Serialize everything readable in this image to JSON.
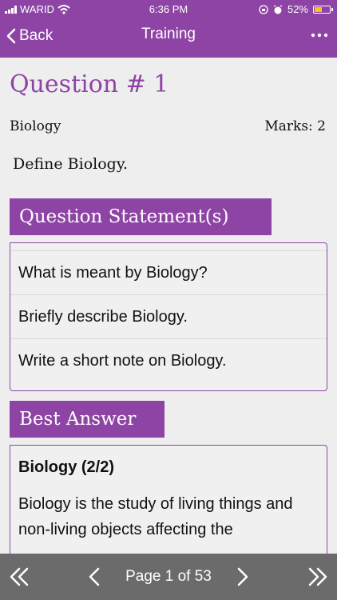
{
  "status": {
    "carrier": "WARID",
    "time": "6:36 PM",
    "battery": "52%",
    "battery_level": 0.52
  },
  "nav": {
    "back_label": "Back",
    "title": "Training"
  },
  "question": {
    "title": "Question # 1",
    "subject": "Biology",
    "marks": "Marks: 2",
    "text": "Define Biology."
  },
  "statements": {
    "header": "Question Statement(s)",
    "items": [
      "What is meant by Biology?",
      "Briefly describe Biology.",
      "Write a short note on Biology."
    ]
  },
  "answer": {
    "header": "Best Answer",
    "title": "Biology (2/2)",
    "text": "Biology is the study of living things and non-living objects affecting the"
  },
  "pager": {
    "label": "Page 1 of 53"
  },
  "colors": {
    "accent": "#8e44a5",
    "bottom_bar": "#6b6b6b"
  }
}
